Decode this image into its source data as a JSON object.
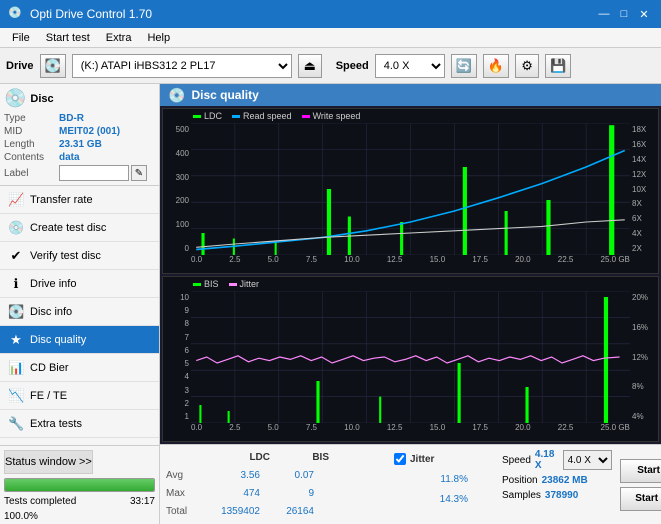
{
  "titlebar": {
    "title": "Opti Drive Control 1.70",
    "minimize": "—",
    "maximize": "□",
    "close": "✕"
  },
  "menu": {
    "items": [
      "File",
      "Start test",
      "Extra",
      "Help"
    ]
  },
  "toolbar": {
    "drive_label": "Drive",
    "drive_value": "(K:) ATAPI iHBS312  2 PL17",
    "speed_label": "Speed",
    "speed_value": "4.0 X"
  },
  "disc": {
    "title": "Disc",
    "type_label": "Type",
    "type_value": "BD-R",
    "mid_label": "MID",
    "mid_value": "MEIT02 (001)",
    "length_label": "Length",
    "length_value": "23.31 GB",
    "contents_label": "Contents",
    "contents_value": "data",
    "label_label": "Label"
  },
  "nav": {
    "items": [
      {
        "id": "transfer-rate",
        "label": "Transfer rate",
        "icon": "📈",
        "active": false
      },
      {
        "id": "create-test-disc",
        "label": "Create test disc",
        "icon": "💿",
        "active": false
      },
      {
        "id": "verify-test-disc",
        "label": "Verify test disc",
        "icon": "✔",
        "active": false
      },
      {
        "id": "drive-info",
        "label": "Drive info",
        "icon": "ℹ",
        "active": false
      },
      {
        "id": "disc-info",
        "label": "Disc info",
        "icon": "💽",
        "active": false
      },
      {
        "id": "disc-quality",
        "label": "Disc quality",
        "icon": "★",
        "active": true
      },
      {
        "id": "cd-bier",
        "label": "CD Bier",
        "icon": "📊",
        "active": false
      },
      {
        "id": "fe-te",
        "label": "FE / TE",
        "icon": "📉",
        "active": false
      },
      {
        "id": "extra-tests",
        "label": "Extra tests",
        "icon": "🔧",
        "active": false
      }
    ]
  },
  "status": {
    "window_btn": "Status window >>",
    "progress": 100,
    "progress_text": "100.0%",
    "time": "33:17"
  },
  "disc_quality": {
    "title": "Disc quality"
  },
  "chart1": {
    "legend": [
      {
        "label": "LDC",
        "color": "#00ff00"
      },
      {
        "label": "Read speed",
        "color": "#00aaff"
      },
      {
        "label": "Write speed",
        "color": "#ff00ff"
      }
    ],
    "y_labels_left": [
      "500",
      "400",
      "300",
      "200",
      "100",
      "0"
    ],
    "y_labels_right": [
      "18X",
      "16X",
      "14X",
      "12X",
      "10X",
      "8X",
      "6X",
      "4X",
      "2X"
    ],
    "x_labels": [
      "0.0",
      "2.5",
      "5.0",
      "7.5",
      "10.0",
      "12.5",
      "15.0",
      "17.5",
      "20.0",
      "22.5",
      "25.0 GB"
    ]
  },
  "chart2": {
    "legend": [
      {
        "label": "BIS",
        "color": "#00ff00"
      },
      {
        "label": "Jitter",
        "color": "#ff88ff"
      }
    ],
    "y_labels_left": [
      "10",
      "9",
      "8",
      "7",
      "6",
      "5",
      "4",
      "3",
      "2",
      "1"
    ],
    "y_labels_right": [
      "20%",
      "16%",
      "12%",
      "8%",
      "4%"
    ],
    "x_labels": [
      "0.0",
      "2.5",
      "5.0",
      "7.5",
      "10.0",
      "12.5",
      "15.0",
      "17.5",
      "20.0",
      "22.5",
      "25.0 GB"
    ]
  },
  "stats": {
    "col_ldc": "LDC",
    "col_bis": "BIS",
    "col_jitter": "Jitter",
    "rows": [
      {
        "label": "Avg",
        "ldc": "3.56",
        "bis": "0.07",
        "jitter": "11.8%"
      },
      {
        "label": "Max",
        "ldc": "474",
        "bis": "9",
        "jitter": "14.3%"
      },
      {
        "label": "Total",
        "ldc": "1359402",
        "bis": "26164",
        "jitter": ""
      }
    ],
    "jitter_checked": true,
    "speed_label": "Speed",
    "speed_val": "4.18 X",
    "speed_select": "4.0 X",
    "position_label": "Position",
    "position_val": "23862 MB",
    "samples_label": "Samples",
    "samples_val": "378990",
    "btn_start_full": "Start full",
    "btn_start_part": "Start part"
  }
}
